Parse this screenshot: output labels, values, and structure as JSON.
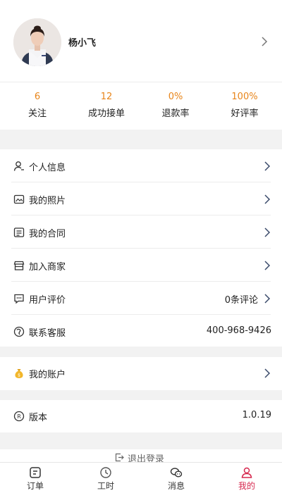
{
  "profile": {
    "name": "杨小飞"
  },
  "stats": [
    {
      "value": "6",
      "label": "关注"
    },
    {
      "value": "12",
      "label": "成功接单"
    },
    {
      "value": "0%",
      "label": "退款率"
    },
    {
      "value": "100%",
      "label": "好评率"
    }
  ],
  "menu": [
    {
      "label": "个人信息",
      "icon": "person-icon"
    },
    {
      "label": "我的照片",
      "icon": "photo-icon"
    },
    {
      "label": "我的合同",
      "icon": "contract-icon"
    },
    {
      "label": "加入商家",
      "icon": "store-icon"
    },
    {
      "label": "用户评价",
      "icon": "comment-icon",
      "value": "0条评论"
    },
    {
      "label": "联系客服",
      "icon": "support-icon",
      "value": "400-968-9426"
    }
  ],
  "account": {
    "label": "我的账户",
    "icon": "money-bag-icon"
  },
  "version": {
    "label": "版本",
    "icon": "registered-icon",
    "value": "1.0.19"
  },
  "logout": {
    "label": "退出登录"
  },
  "tabs": [
    {
      "label": "订单",
      "icon": "order-icon"
    },
    {
      "label": "工时",
      "icon": "clock-icon"
    },
    {
      "label": "消息",
      "icon": "chat-icon"
    },
    {
      "label": "我的",
      "icon": "profile-icon",
      "active": true
    }
  ],
  "colors": {
    "accent": "#e8851a",
    "active_tab": "#d6284e",
    "background": "#f2f2f2"
  }
}
